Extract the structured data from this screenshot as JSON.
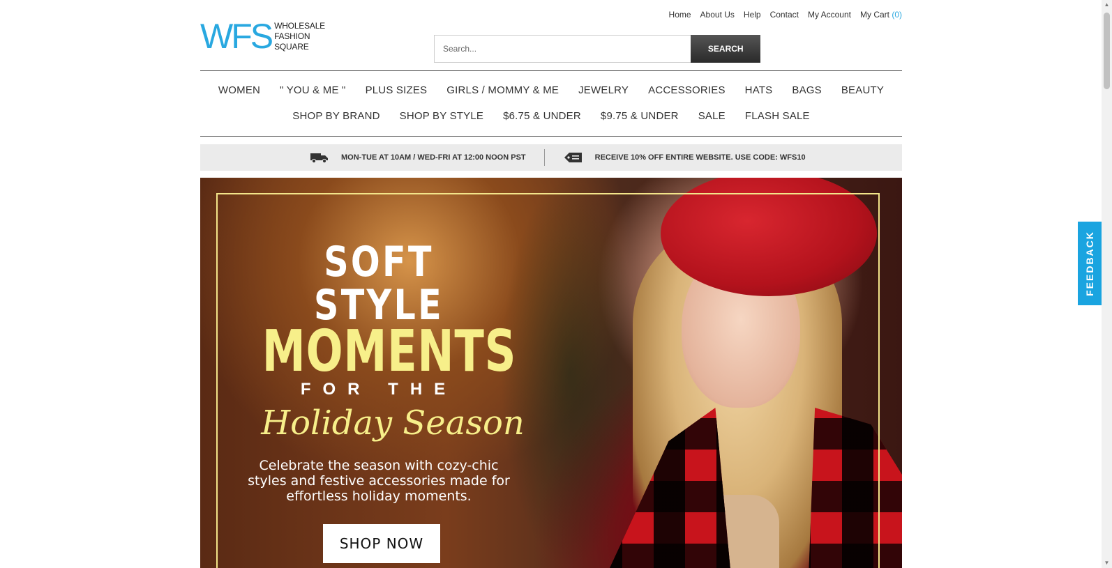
{
  "header": {
    "logo_mark": "WFS",
    "logo_lines": [
      "WHOLESALE",
      "FASHION",
      "SQUARE"
    ],
    "top_links": [
      "Home",
      "About Us",
      "Help",
      "Contact",
      "My Account"
    ],
    "cart_label": "My Cart",
    "cart_count": "(0)",
    "search_placeholder": "Search...",
    "search_button": "SEARCH"
  },
  "nav": {
    "row1": [
      "WOMEN",
      "\" YOU & ME \"",
      "PLUS SIZES",
      "GIRLS / MOMMY & ME",
      "JEWELRY",
      "ACCESSORIES",
      "HATS",
      "BAGS",
      "BEAUTY"
    ],
    "row2": [
      "SHOP BY BRAND",
      "SHOP BY STYLE",
      "$6.75 & UNDER",
      "$9.75 & UNDER",
      "SALE",
      "FLASH SALE"
    ]
  },
  "promo": {
    "shipping_text": "MON-TUE AT 10AM / WED-FRI AT 12:00 NOON PST",
    "coupon_text": "RECEIVE 10% OFF ENTIRE WEBSITE. USE CODE: WFS10",
    "shipping_icon": "truck-icon",
    "coupon_icon": "tag-icon"
  },
  "hero": {
    "line1": "SOFT STYLE",
    "line2": "MOMENTS",
    "line3": "FOR THE",
    "line4": "Holiday Season",
    "subtitle": "Celebrate the season with cozy-chic styles and festive accessories made for effortless holiday moments.",
    "cta": "SHOP NOW",
    "accent_color": "#f7ef8a"
  },
  "feedback_tab": "FEEDBACK",
  "colors": {
    "brand": "#29a8e0",
    "feedback": "#1aa4e0",
    "search_button": "#333333"
  }
}
